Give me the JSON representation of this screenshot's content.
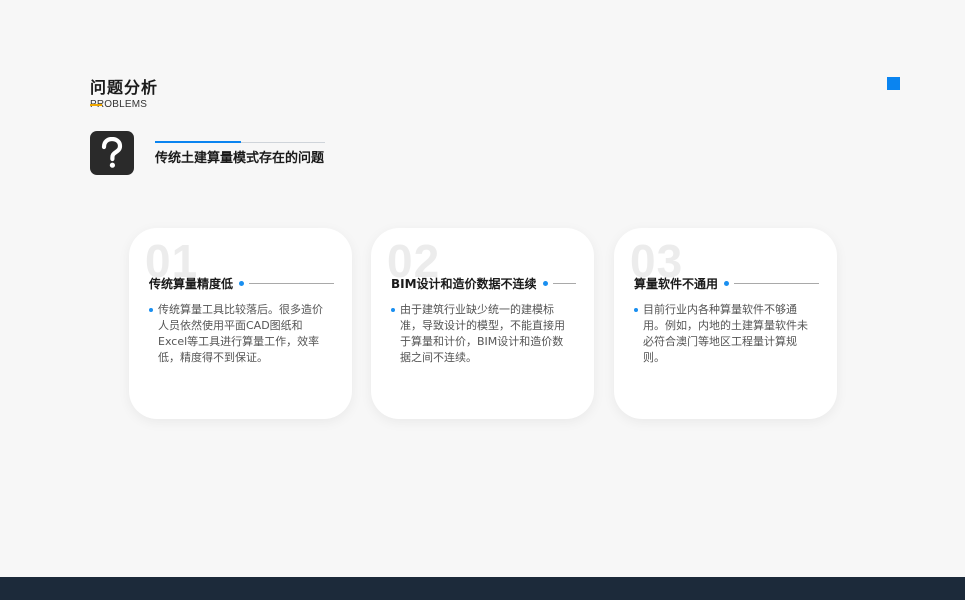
{
  "header": {
    "title": "问题分析",
    "subtitle": "PROBLEMS"
  },
  "section": {
    "icon": "question-mark-icon",
    "heading": "传统土建算量模式存在的问题"
  },
  "cards": [
    {
      "number": "01",
      "title": "传统算量精度低",
      "text": "传统算量工具比较落后。很多造价人员依然使用平面CAD图纸和Excel等工具进行算量工作，效率低，精度得不到保证。"
    },
    {
      "number": "02",
      "title": "BIM设计和造价数据不连续",
      "text": "由于建筑行业缺少统一的建模标准，导致设计的模型，不能直接用于算量和计价，BIM设计和造价数据之间不连续。"
    },
    {
      "number": "03",
      "title": "算量软件不通用",
      "text": "目前行业内各种算量软件不够通用。例如，内地的土建算量软件未必符合澳门等地区工程量计算规则。"
    }
  ],
  "colors": {
    "accent": "#0a84f0",
    "underline": "#f0a800",
    "footer": "#1c2a3a",
    "background": "#f7f7f7"
  }
}
